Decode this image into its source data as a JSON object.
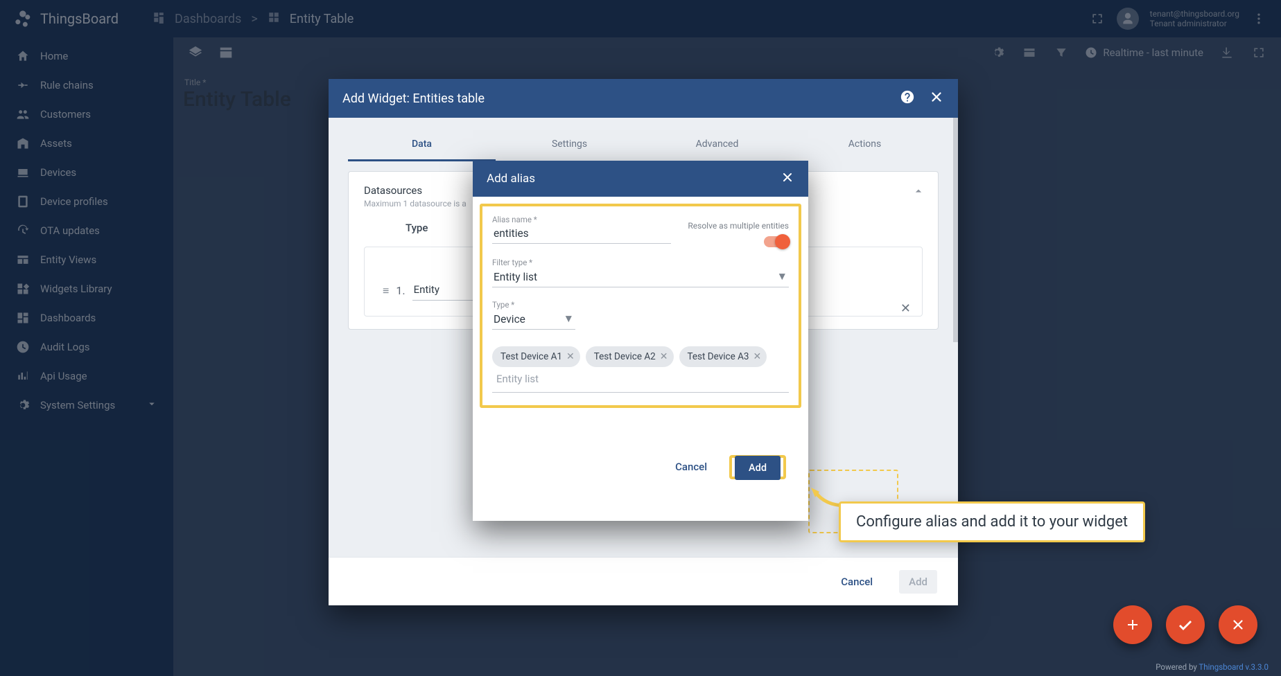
{
  "app": {
    "name": "ThingsBoard"
  },
  "header": {
    "breadcrumb": [
      "Dashboards",
      ">",
      "Entity Table"
    ],
    "tenant_email": "tenant@thingsboard.org",
    "tenant_role": "Tenant administrator"
  },
  "sidebar": {
    "items": [
      {
        "label": "Home",
        "icon": "home"
      },
      {
        "label": "Rule chains",
        "icon": "rulechain"
      },
      {
        "label": "Customers",
        "icon": "customers"
      },
      {
        "label": "Assets",
        "icon": "assets"
      },
      {
        "label": "Devices",
        "icon": "devices"
      },
      {
        "label": "Device profiles",
        "icon": "profiles"
      },
      {
        "label": "OTA updates",
        "icon": "ota"
      },
      {
        "label": "Entity Views",
        "icon": "entityviews"
      },
      {
        "label": "Widgets Library",
        "icon": "widgets"
      },
      {
        "label": "Dashboards",
        "icon": "dashboards"
      },
      {
        "label": "Audit Logs",
        "icon": "audit"
      },
      {
        "label": "Api Usage",
        "icon": "api"
      },
      {
        "label": "System Settings",
        "icon": "settings"
      }
    ]
  },
  "toolbar": {
    "timewindow": "Realtime - last minute"
  },
  "canvas": {
    "title_label": "Title *",
    "title_value": "Entity Table"
  },
  "addwidget": {
    "title": "Add Widget: Entities table",
    "tabs": [
      "Data",
      "Settings",
      "Advanced",
      "Actions"
    ],
    "datasources_label": "Datasources",
    "datasources_sub": "Maximum 1 datasource is a",
    "type_label": "Type",
    "row_index": "1.",
    "row_type_value": "Entity",
    "footer_cancel": "Cancel",
    "footer_add": "Add"
  },
  "addalias": {
    "title": "Add alias",
    "alias_name_label": "Alias name *",
    "alias_name_value": "entities",
    "resolve_label": "Resolve as multiple entities",
    "resolve_value": true,
    "filter_type_label": "Filter type *",
    "filter_type_value": "Entity list",
    "type_label": "Type *",
    "type_value": "Device",
    "chips": [
      "Test Device A1",
      "Test Device A2",
      "Test Device A3"
    ],
    "entity_list_placeholder": "Entity list",
    "cancel": "Cancel",
    "add": "Add"
  },
  "annotation": {
    "text": "Configure alias and add it to your widget"
  },
  "footer": {
    "prefix": "Powered by ",
    "link": "Thingsboard v.3.3.0"
  }
}
